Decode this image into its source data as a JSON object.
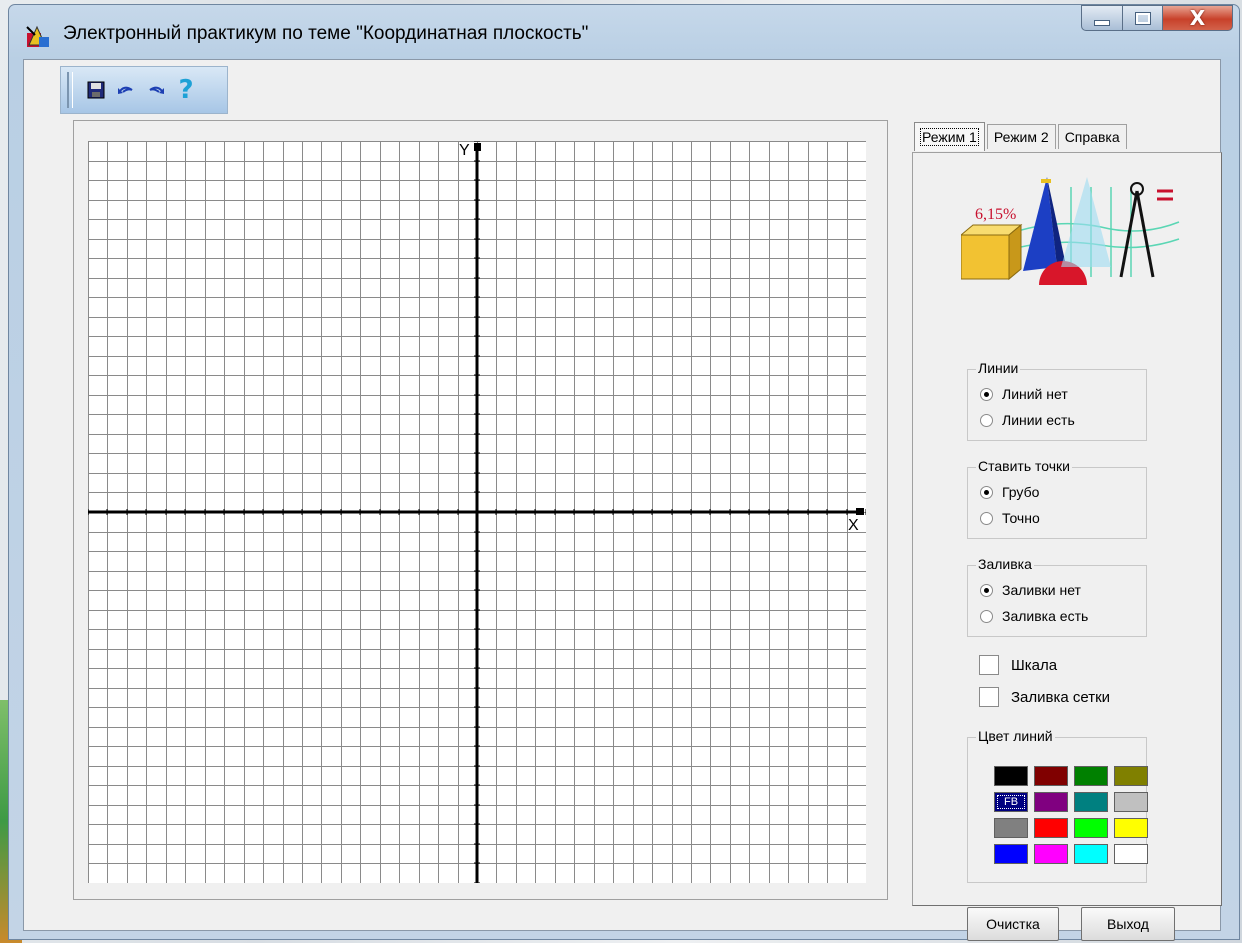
{
  "window": {
    "title": "Электронный практикум по теме \"Координатная плоскость\"",
    "controls": {
      "close_glyph": "X"
    }
  },
  "toolbar": {
    "buttons": [
      {
        "icon": "save-icon"
      },
      {
        "icon": "undo-icon"
      },
      {
        "icon": "redo-icon"
      },
      {
        "icon": "help-icon",
        "glyph": "?"
      }
    ]
  },
  "plane": {
    "x_axis_label": "X",
    "y_axis_label": "Y",
    "grid_columns": 40,
    "grid_rows": 38,
    "grid_color": "#8a8a8a",
    "axis_color": "#000000"
  },
  "tabs": [
    {
      "label": "Режим 1",
      "active": true
    },
    {
      "label": "Режим 2",
      "active": false
    },
    {
      "label": "Справка",
      "active": false
    }
  ],
  "panel": {
    "clipart": {
      "percent_text": "6,15%"
    },
    "lines_group": {
      "title": "Линии",
      "options": [
        {
          "label": "Линий нет",
          "selected": true
        },
        {
          "label": "Линии есть",
          "selected": false
        }
      ]
    },
    "points_group": {
      "title": "Ставить точки",
      "options": [
        {
          "label": "Грубо",
          "selected": true
        },
        {
          "label": "Точно",
          "selected": false
        }
      ]
    },
    "fill_group": {
      "title": "Заливка",
      "options": [
        {
          "label": "Заливки нет",
          "selected": true
        },
        {
          "label": "Заливка есть",
          "selected": false
        }
      ]
    },
    "scale_checkbox": {
      "label": "Шкала",
      "checked": false
    },
    "grid_fill_checkbox": {
      "label": "Заливка сетки",
      "checked": false
    },
    "line_color_group": {
      "title": "Цвет линий",
      "selected_label": "FB",
      "swatches": [
        "#000000",
        "#800000",
        "#008000",
        "#808000",
        "#000080",
        "#800080",
        "#008080",
        "#c0c0c0",
        "#808080",
        "#ff0000",
        "#00ff00",
        "#ffff00",
        "#0000ff",
        "#ff00ff",
        "#00ffff",
        "#ffffff"
      ]
    },
    "clear_button": "Очистка",
    "exit_button": "Выход"
  }
}
